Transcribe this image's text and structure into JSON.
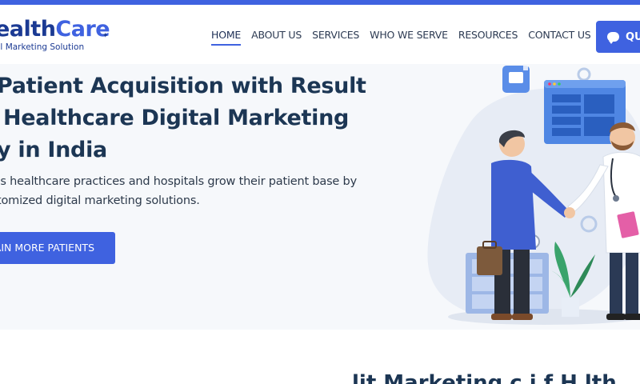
{
  "brand": {
    "name_part1": "ealth",
    "name_part2": "Care",
    "tagline": "al Marketing Solution",
    "accent_color": "#3f62e0",
    "dark_color": "#1b3a93"
  },
  "nav": {
    "items": [
      {
        "label": "HOME",
        "active": true
      },
      {
        "label": "ABOUT US",
        "active": false
      },
      {
        "label": "SERVICES",
        "active": false
      },
      {
        "label": "WHO WE SERVE",
        "active": false
      },
      {
        "label": "RESOURCES",
        "active": false
      },
      {
        "label": "CONTACT US",
        "active": false
      }
    ],
    "quote_button": {
      "label": "QU",
      "icon": "chat-bubble-icon"
    }
  },
  "hero": {
    "title_line1": "Patient Acquisition with Result",
    "title_line2": "Healthcare Digital Marketing",
    "title_line3": "y in India",
    "subtitle_line1": "’s healthcare practices and hospitals grow their patient base by",
    "subtitle_line2": "tomized digital marketing solutions.",
    "cta_label": "AIN MORE PATIENTS",
    "illustration": "doctor-patient-handshake-illustration"
  },
  "below": {
    "partial_heading": "lit      Marketing      c i       f        H  lth     "
  }
}
